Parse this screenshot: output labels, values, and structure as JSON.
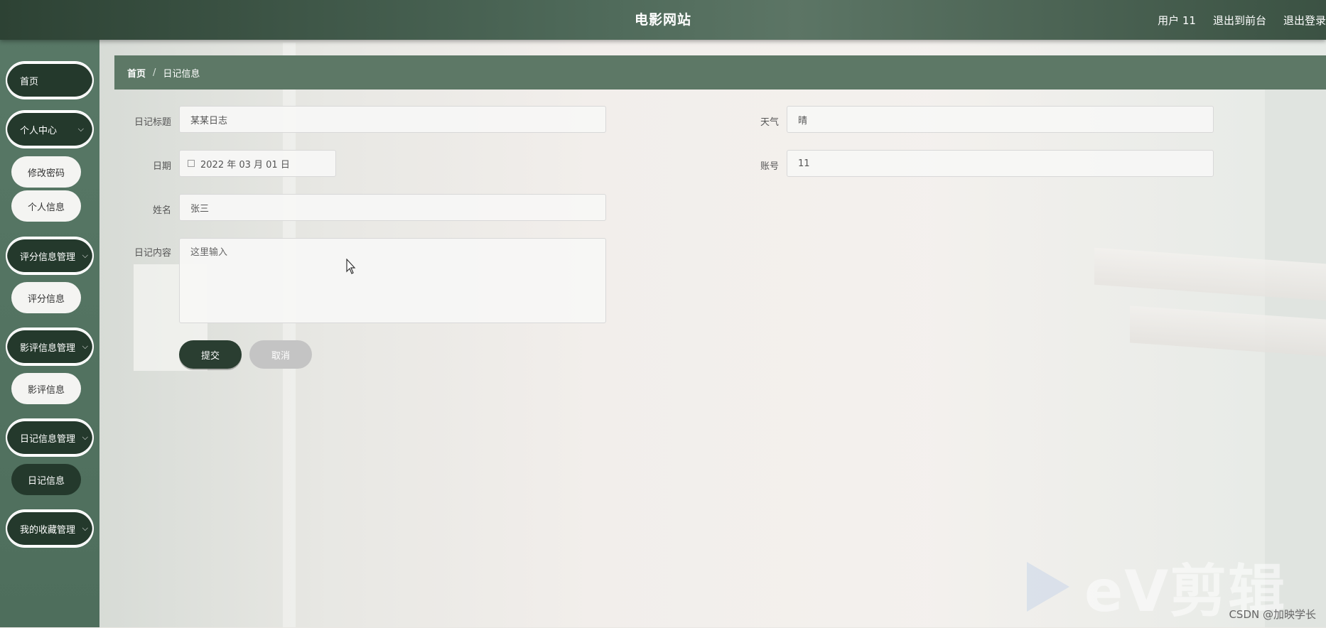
{
  "header": {
    "site_title": "电影网站",
    "user_label": "用户 11",
    "exit_front": "退出到前台",
    "logout": "退出登录"
  },
  "sidebar": {
    "home": "首页",
    "personal_center": "个人中心",
    "change_password": "修改密码",
    "personal_info": "个人信息",
    "rating_mgmt": "评分信息管理",
    "rating_info": "评分信息",
    "review_mgmt": "影评信息管理",
    "review_info": "影评信息",
    "diary_mgmt": "日记信息管理",
    "diary_info": "日记信息",
    "favorites_mgmt": "我的收藏管理",
    "chevron": "⌵"
  },
  "breadcrumb": {
    "home": "首页",
    "separator": "/",
    "current": "日记信息"
  },
  "form": {
    "title_label": "日记标题",
    "title_value": "某某日志",
    "weather_label": "天气",
    "weather_value": "晴",
    "date_label": "日期",
    "date_value": "2022 年 03 月 01 日",
    "account_label": "账号",
    "account_value": "11",
    "name_label": "姓名",
    "name_value": "张三",
    "content_label": "日记内容",
    "content_placeholder": "这里输入"
  },
  "buttons": {
    "submit": "提交",
    "cancel": "取消"
  },
  "watermark": {
    "ev_text": "eV剪辑",
    "csdn": "CSDN @加映学长"
  }
}
